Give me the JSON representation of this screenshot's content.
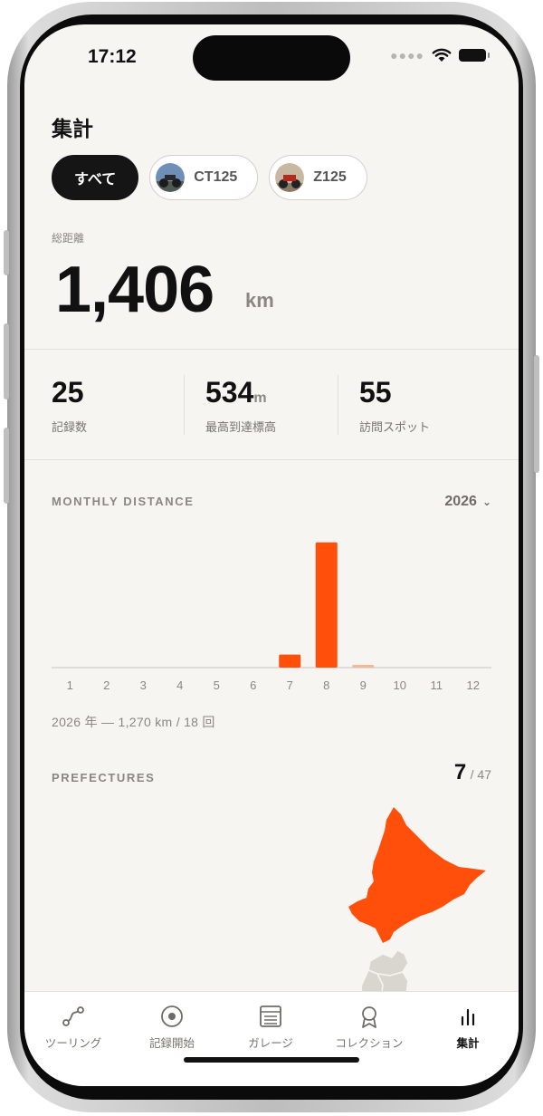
{
  "status": {
    "time": "17:12"
  },
  "header": {
    "title": "集計"
  },
  "filters": [
    {
      "label": "すべて",
      "active": true
    },
    {
      "label": "CT125",
      "active": false
    },
    {
      "label": "Z125",
      "active": false
    }
  ],
  "total_distance": {
    "label": "総距離",
    "value": "1,406",
    "unit": "km"
  },
  "stats": [
    {
      "value": "25",
      "unit": "",
      "label": "記録数"
    },
    {
      "value": "534",
      "unit": "m",
      "label": "最高到達標高"
    },
    {
      "value": "55",
      "unit": "",
      "label": "訪問スポット"
    }
  ],
  "monthly": {
    "label": "MONTHLY DISTANCE",
    "year": "2026",
    "summary": "2026 年 — 1,270 km / 18 回"
  },
  "chart_data": {
    "type": "bar",
    "categories": [
      "1",
      "2",
      "3",
      "4",
      "5",
      "6",
      "7",
      "8",
      "9",
      "10",
      "11",
      "12"
    ],
    "values": [
      0,
      0,
      0,
      0,
      0,
      0,
      100,
      960,
      15,
      0,
      0,
      0
    ],
    "xlabel": "",
    "ylabel": "",
    "ylim": [
      0,
      1000
    ],
    "grid": false,
    "colors": {
      "bar": "#ff4f0a",
      "bar_faint": "#f3b79a",
      "axis": "#cfcdc8"
    }
  },
  "prefectures": {
    "label": "PREFECTURES",
    "visited": "7",
    "total": "/ 47"
  },
  "tabs": [
    {
      "label": "ツーリング",
      "icon": "route-icon",
      "active": false
    },
    {
      "label": "記録開始",
      "icon": "record-icon",
      "active": false
    },
    {
      "label": "ガレージ",
      "icon": "garage-icon",
      "active": false
    },
    {
      "label": "コレクション",
      "icon": "badge-icon",
      "active": false
    },
    {
      "label": "集計",
      "icon": "stats-icon",
      "active": true
    }
  ],
  "colors": {
    "accent": "#ff4f0a",
    "background": "#f6f5f2",
    "dark": "#151515"
  }
}
